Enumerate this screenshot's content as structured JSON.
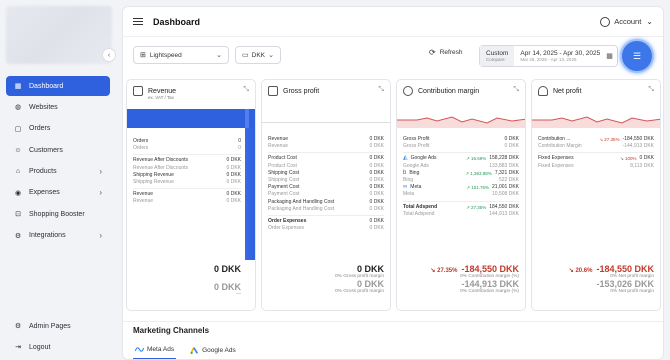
{
  "sidebar": {
    "items": [
      {
        "label": "Dashboard",
        "icon": "dashboard-icon",
        "active": true
      },
      {
        "label": "Websites",
        "icon": "globe-icon"
      },
      {
        "label": "Orders",
        "icon": "box-icon"
      },
      {
        "label": "Customers",
        "icon": "users-icon"
      },
      {
        "label": "Products",
        "icon": "tag-icon",
        "chevron": "›"
      },
      {
        "label": "Expenses",
        "icon": "coins-icon",
        "chevron": "›"
      },
      {
        "label": "Shopping Booster",
        "icon": "cart-icon"
      },
      {
        "label": "Integrations",
        "icon": "plug-icon",
        "chevron": "›"
      }
    ],
    "bottom": [
      {
        "label": "Admin Pages",
        "icon": "gear-icon"
      },
      {
        "label": "Logout",
        "icon": "logout-icon"
      }
    ],
    "collapse": "‹"
  },
  "header": {
    "title": "Dashboard",
    "account": "Account",
    "account_chevron": "⌄"
  },
  "filters": {
    "store": "Lightspeed",
    "currency": "DKK",
    "refresh": "Refresh",
    "custom": "Custom",
    "compare": "Compare:",
    "date_range": "Apr 14, 2025 - Apr 30, 2025",
    "compare_range": "Mar 26, 2025 - Apr 13, 2025"
  },
  "cards": {
    "revenue": {
      "title": "Revenue",
      "subtitle": "ex. VAT / Tax",
      "rows": [
        {
          "l": "Orders",
          "v": "0"
        },
        {
          "l": "Orders",
          "v": "0",
          "sub": true
        },
        {
          "sep": true
        },
        {
          "l": "Revenue After Discounts",
          "v": "0 DKK"
        },
        {
          "l": "Revenue After Discounts",
          "v": "0 DKK",
          "sub": true
        },
        {
          "l": "Shipping Revenue",
          "v": "0 DKK"
        },
        {
          "l": "Shipping Revenue",
          "v": "0 DKK",
          "sub": true
        },
        {
          "sep": true
        },
        {
          "l": "Revenue",
          "v": "0 DKK"
        },
        {
          "l": "Revenue",
          "v": "0 DKK",
          "sub": true
        }
      ],
      "total": "0 DKK",
      "compare_total": "0 DKK",
      "caption": "—"
    },
    "gross": {
      "title": "Gross profit",
      "rows": [
        {
          "l": "Revenue",
          "v": "0 DKK"
        },
        {
          "l": "Revenue",
          "v": "0 DKK",
          "sub": true
        },
        {
          "sep": true
        },
        {
          "l": "Product Cost",
          "v": "0 DKK"
        },
        {
          "l": "Product Cost",
          "v": "0 DKK",
          "sub": true
        },
        {
          "l": "Shipping Cost",
          "v": "0 DKK"
        },
        {
          "l": "Shipping Cost",
          "v": "0 DKK",
          "sub": true
        },
        {
          "l": "Payment Cost",
          "v": "0 DKK"
        },
        {
          "l": "Payment Cost",
          "v": "0 DKK",
          "sub": true
        },
        {
          "l": "Packaging And Handling Cost",
          "v": "0 DKK"
        },
        {
          "l": "Packaging And Handling Cost",
          "v": "0 DKK",
          "sub": true
        },
        {
          "sep": true
        },
        {
          "l": "Order Expenses",
          "v": "0 DKK",
          "bold": true
        },
        {
          "l": "Order Expenses",
          "v": "0 DKK",
          "sub": true
        }
      ],
      "total": "0 DKK",
      "caption1": "0% Gross profit margin",
      "compare_total": "0 DKK",
      "caption2": "0% Gross profit margin"
    },
    "contribution": {
      "title": "Contribution margin",
      "rows": [
        {
          "l": "Gross Profit",
          "v": "0 DKK"
        },
        {
          "l": "Gross Profit",
          "v": "0 DKK",
          "sub": true
        },
        {
          "sep": true
        },
        {
          "l": "Google Ads",
          "ch": "↗ 16.69%",
          "v": "158,228 DKK",
          "icon": "google-ads-icon"
        },
        {
          "l": "Google Ads",
          "v": "133,883 DKK",
          "sub": true
        },
        {
          "l": "Bing",
          "ch": "↗ 1,363.88%",
          "v": "7,321 DKK",
          "icon": "bing-icon"
        },
        {
          "l": "Bing",
          "v": "522 DKK",
          "sub": true
        },
        {
          "l": "Meta",
          "ch": "↗ 101.76%",
          "v": "21,001 DKK",
          "icon": "meta-icon"
        },
        {
          "l": "Meta",
          "v": "10,508 DKK",
          "sub": true
        },
        {
          "sep": true
        },
        {
          "l": "Total Adspend",
          "ch": "↗ 27.35%",
          "v": "184,550 DKK",
          "bold": true
        },
        {
          "l": "Total Adspend",
          "v": "144,913 DKK",
          "sub": true
        }
      ],
      "change": "↘ 27.35%",
      "total": "-184,550 DKK",
      "caption1": "0% Contribution margin (%)",
      "compare_total": "-144,913 DKK",
      "caption2": "0% Contribution margin (%)"
    },
    "net": {
      "title": "Net profit",
      "rows": [
        {
          "l": "Contribution ...",
          "ch": "↘ 27.35%",
          "v": "-184,550 DKK",
          "neg": true
        },
        {
          "l": "Contribution Margin",
          "v": "-144,913 DKK",
          "sub": true
        },
        {
          "sep": true
        },
        {
          "l": "Fixed Expenses",
          "ch": "↘ 100%",
          "v": "0 DKK"
        },
        {
          "l": "Fixed Expenses",
          "v": "8,113 DKK",
          "sub": true
        }
      ],
      "change": "↘ 20.6%",
      "total": "-184,550 DKK",
      "caption1": "0% Net profit margin",
      "compare_total": "-153,026 DKK",
      "caption2": "0% Net profit margin"
    }
  },
  "marketing": {
    "title": "Marketing Channels",
    "tabs": [
      {
        "label": "Meta Ads",
        "active": true
      },
      {
        "label": "Google Ads"
      }
    ]
  },
  "colors": {
    "accent": "#2f61de",
    "negative": "#c0392b",
    "positive": "#1e9b53"
  }
}
